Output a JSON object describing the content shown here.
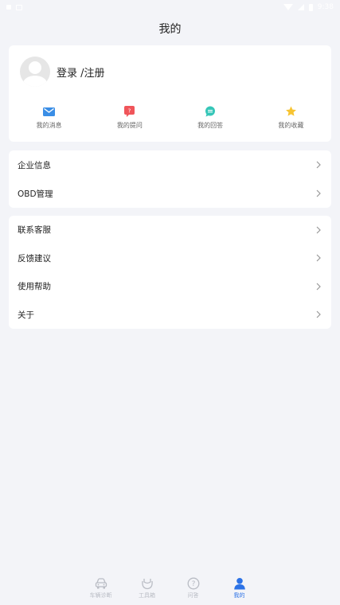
{
  "status_bar": {
    "time": "9:38"
  },
  "header": {
    "title": "我的"
  },
  "profile": {
    "login_label": "登录 /注册"
  },
  "quick_actions": [
    {
      "label": "我的消息",
      "icon": "mail-icon",
      "color": "#3a8ee6"
    },
    {
      "label": "我的提问",
      "icon": "question-bubble-icon",
      "color": "#f0555a"
    },
    {
      "label": "我的回答",
      "icon": "chat-bubble-icon",
      "color": "#36c6b8"
    },
    {
      "label": "我的收藏",
      "icon": "star-icon",
      "color": "#f7c432"
    }
  ],
  "menu_group_1": [
    {
      "label": "企业信息"
    },
    {
      "label": "OBD管理"
    }
  ],
  "menu_group_2": [
    {
      "label": "联系客服"
    },
    {
      "label": "反馈建议"
    },
    {
      "label": "使用帮助"
    },
    {
      "label": "关于"
    }
  ],
  "tab_bar": {
    "tabs": [
      {
        "label": "车辆诊断",
        "icon": "car-icon",
        "active": false
      },
      {
        "label": "工具箱",
        "icon": "toolbox-icon",
        "active": false
      },
      {
        "label": "问答",
        "icon": "question-circle-icon",
        "active": false
      },
      {
        "label": "我的",
        "icon": "user-icon",
        "active": true
      }
    ]
  },
  "colors": {
    "accent": "#2c72e6",
    "background": "#f3f4f8",
    "inactive_tab": "#b9bcc4"
  }
}
